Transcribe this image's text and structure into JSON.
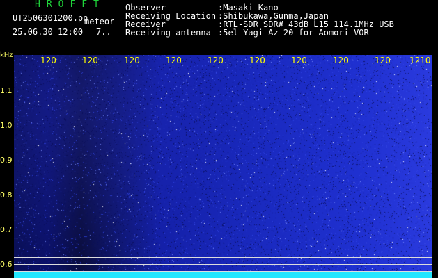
{
  "header": {
    "app_title": "HROFFT",
    "file_name": "UT2506301200.pn",
    "meteor_label": "meteor",
    "date_time": "25.06.30 12:00",
    "count_value": "7..",
    "observer_label": "Observer",
    "observer_value": ":Masaki Kano",
    "location_label": "Receiving Location",
    "location_value": ":Shibukawa,Gunma,Japan",
    "receiver_label": "Receiver",
    "receiver_value": ":RTL-SDR SDR# 43dB L15 114.1MHz USB",
    "antenna_label": "Receiving antenna",
    "antenna_value": ":5el Yagi Az 20 for Aomori VOR"
  },
  "axes": {
    "y_unit": "kHz",
    "y_ticks": [
      "1.1",
      "1.0",
      "0.9",
      "0.8",
      "0.7",
      "0.6"
    ],
    "x_ticks": [
      "120",
      "120",
      "120",
      "120",
      "120",
      "120",
      "120",
      "120",
      "120",
      "120",
      "1210"
    ]
  },
  "colors": {
    "title_green": "#1fd43a",
    "tick_yellow": "#ffff00",
    "baseline_cyan": "#22e6ff",
    "background": "#000000"
  }
}
